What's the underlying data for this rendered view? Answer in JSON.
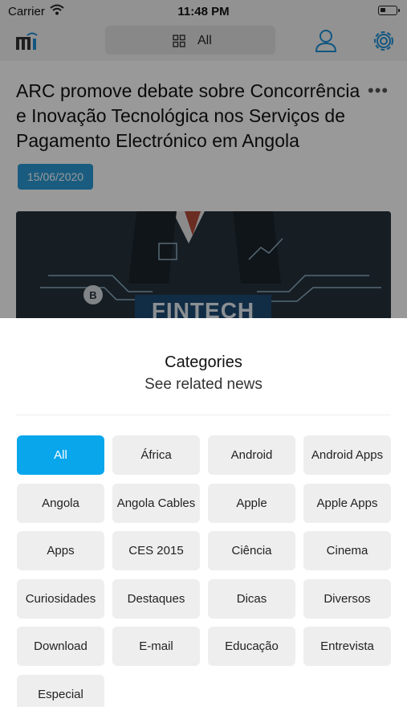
{
  "status_bar": {
    "carrier": "Carrier",
    "time": "11:48 PM"
  },
  "nav": {
    "segment_label": "All"
  },
  "article": {
    "title": "ARC promove debate sobre Concorrência e Inovação Tecnológica nos Serviços de Pagamento Electrónico em Angola",
    "date": "15/06/2020",
    "more_label": "•••",
    "image_text": "FINTECH"
  },
  "sheet": {
    "title": "Categories",
    "subtitle": "See related news",
    "categories": [
      "All",
      "África",
      "Android",
      "Android Apps",
      "Angola",
      "Angola Cables",
      "Apple",
      "Apple Apps",
      "Apps",
      "CES 2015",
      "Ciência",
      "Cinema",
      "Curiosidades",
      "Destaques",
      "Dicas",
      "Diversos",
      "Download",
      "E-mail",
      "Educação",
      "Entrevista",
      "Especial"
    ],
    "selected_index": 0
  },
  "colors": {
    "accent": "#0aa6ec",
    "date_badge": "#2c9ad6",
    "icon_blue": "#1f8fd6"
  }
}
